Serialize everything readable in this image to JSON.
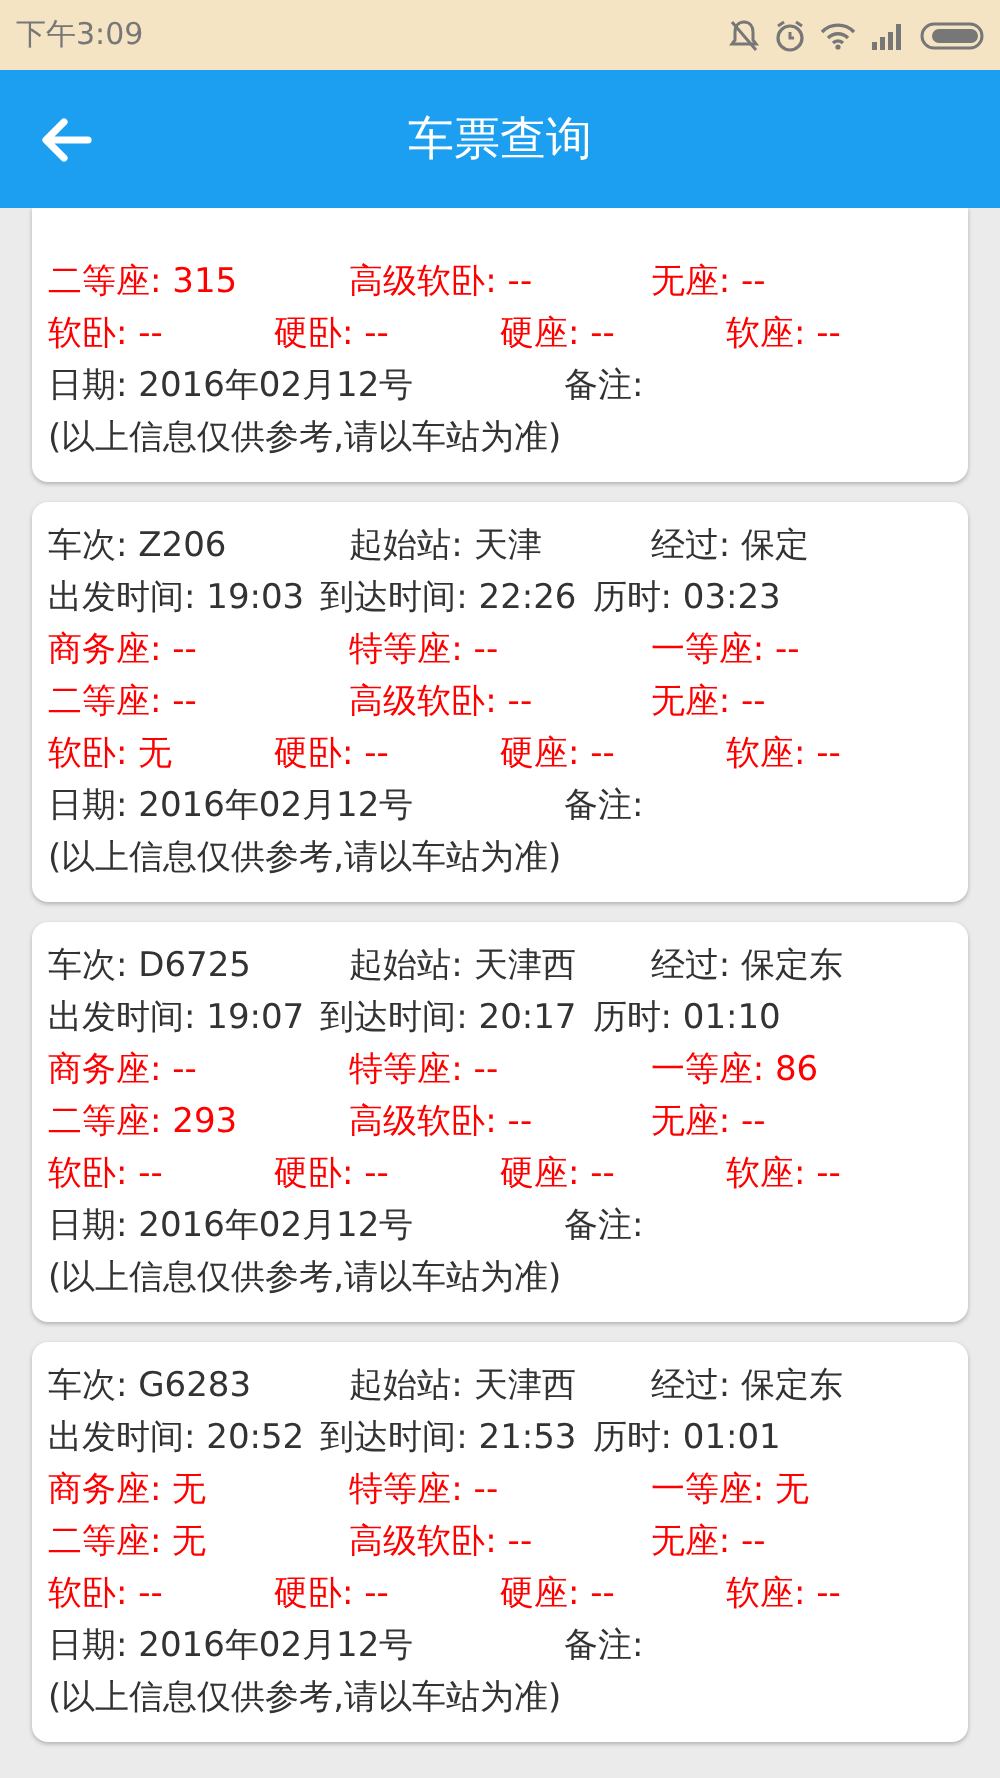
{
  "status_bar": {
    "time": "下午3:09"
  },
  "app_bar": {
    "title": "车票查询"
  },
  "cards": [
    {
      "clipped_top": true,
      "rows": [
        {
          "kind": "seats3",
          "cells": [
            "二等座: 315",
            "高级软卧: --",
            "无座: --"
          ]
        },
        {
          "kind": "seats4",
          "cells": [
            "软卧: --",
            "硬卧: --",
            "硬座: --",
            "软座: --"
          ]
        },
        {
          "kind": "date",
          "cells": [
            "日期: 2016年02月12号",
            "备注:"
          ]
        },
        {
          "kind": "note",
          "cells": [
            "(以上信息仅供参考,请以车站为准)"
          ]
        }
      ]
    },
    {
      "clipped_top": false,
      "rows": [
        {
          "kind": "info",
          "cells": [
            "车次: Z206",
            "起始站: 天津",
            "经过: 保定"
          ]
        },
        {
          "kind": "times",
          "cells": [
            "出发时间: 19:03",
            "到达时间: 22:26",
            "历时: 03:23"
          ]
        },
        {
          "kind": "seats3",
          "cells": [
            "商务座: --",
            "特等座: --",
            "一等座: --"
          ]
        },
        {
          "kind": "seats3",
          "cells": [
            "二等座: --",
            "高级软卧: --",
            "无座: --"
          ]
        },
        {
          "kind": "seats4",
          "cells": [
            "软卧: 无",
            "硬卧: --",
            "硬座: --",
            "软座: --"
          ]
        },
        {
          "kind": "date",
          "cells": [
            "日期: 2016年02月12号",
            "备注:"
          ]
        },
        {
          "kind": "note",
          "cells": [
            "(以上信息仅供参考,请以车站为准)"
          ]
        }
      ]
    },
    {
      "clipped_top": false,
      "rows": [
        {
          "kind": "info",
          "cells": [
            "车次: D6725",
            "起始站: 天津西",
            "经过: 保定东"
          ]
        },
        {
          "kind": "times",
          "cells": [
            "出发时间: 19:07",
            "到达时间: 20:17",
            "历时: 01:10"
          ]
        },
        {
          "kind": "seats3",
          "cells": [
            "商务座: --",
            "特等座: --",
            "一等座: 86"
          ]
        },
        {
          "kind": "seats3",
          "cells": [
            "二等座: 293",
            "高级软卧: --",
            "无座: --"
          ]
        },
        {
          "kind": "seats4",
          "cells": [
            "软卧: --",
            "硬卧: --",
            "硬座: --",
            "软座: --"
          ]
        },
        {
          "kind": "date",
          "cells": [
            "日期: 2016年02月12号",
            "备注:"
          ]
        },
        {
          "kind": "note",
          "cells": [
            "(以上信息仅供参考,请以车站为准)"
          ]
        }
      ]
    },
    {
      "clipped_top": false,
      "rows": [
        {
          "kind": "info",
          "cells": [
            "车次: G6283",
            "起始站: 天津西",
            "经过: 保定东"
          ]
        },
        {
          "kind": "times",
          "cells": [
            "出发时间: 20:52",
            "到达时间: 21:53",
            "历时: 01:01"
          ]
        },
        {
          "kind": "seats3",
          "cells": [
            "商务座: 无",
            "特等座: --",
            "一等座: 无"
          ]
        },
        {
          "kind": "seats3",
          "cells": [
            "二等座: 无",
            "高级软卧: --",
            "无座: --"
          ]
        },
        {
          "kind": "seats4",
          "cells": [
            "软卧: --",
            "硬卧: --",
            "硬座: --",
            "软座: --"
          ]
        },
        {
          "kind": "date",
          "cells": [
            "日期: 2016年02月12号",
            "备注:"
          ]
        },
        {
          "kind": "note",
          "cells": [
            "(以上信息仅供参考,请以车站为准)"
          ]
        }
      ]
    }
  ]
}
